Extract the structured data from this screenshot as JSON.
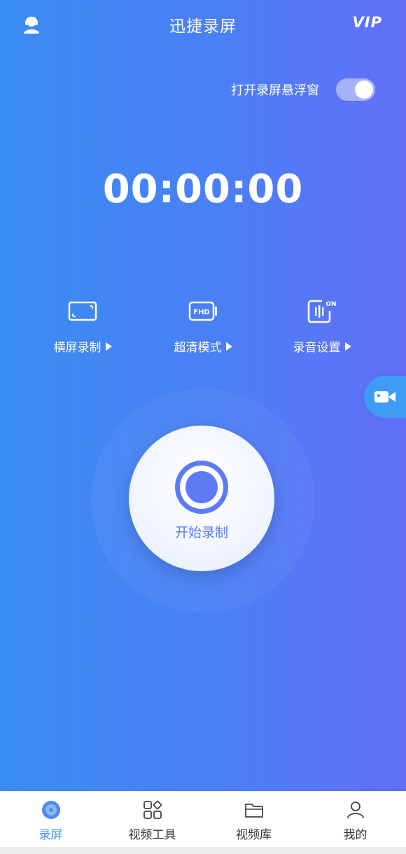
{
  "header": {
    "title": "迅捷录屏",
    "vip": "VIP",
    "user_icon": "user-support-icon"
  },
  "floating_window": {
    "label": "打开录屏悬浮窗",
    "enabled": true
  },
  "timer": "00:00:00",
  "options": [
    {
      "label": "横屏录制",
      "icon": "landscape-screen-icon"
    },
    {
      "label": "超清模式",
      "icon": "fhd-icon"
    },
    {
      "label": "录音设置",
      "icon": "audio-on-icon",
      "badge": "ON"
    }
  ],
  "fhd_icon_text": "FHD",
  "record": {
    "label": "开始录制"
  },
  "side_button": {
    "icon": "video-camera-icon"
  },
  "tabs": [
    {
      "label": "录屏",
      "icon": "disc-icon",
      "active": true
    },
    {
      "label": "视频工具",
      "icon": "apps-grid-icon",
      "active": false
    },
    {
      "label": "视频库",
      "icon": "folder-icon",
      "active": false
    },
    {
      "label": "我的",
      "icon": "person-icon",
      "active": false
    }
  ],
  "colors": {
    "accent": "#5d79f3",
    "tab_active": "#4a8df4",
    "gradient_start": "#3a8cf3",
    "gradient_end": "#626ff9"
  }
}
